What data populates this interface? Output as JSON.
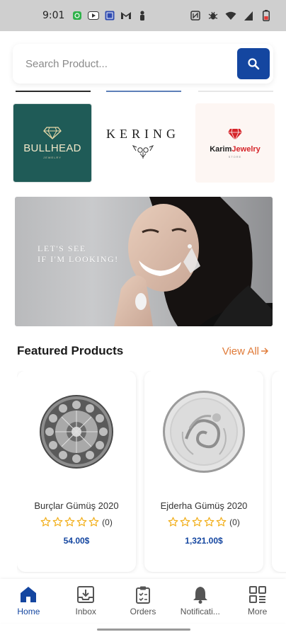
{
  "status_bar": {
    "time": "9:01",
    "left_icons": [
      "whatsapp-icon",
      "youtube-icon",
      "app-icon",
      "gmail-icon",
      "person-icon"
    ],
    "right_icons": [
      "nfc-icon",
      "bug-icon",
      "wifi-icon",
      "signal-icon",
      "battery-icon"
    ]
  },
  "search": {
    "placeholder": "Search Product...",
    "value": ""
  },
  "brands": [
    {
      "name": "BULLHEAD",
      "subtitle": "JEWELRY"
    },
    {
      "name": "KERING"
    },
    {
      "name": "Karim",
      "name_highlight": "Jewelry",
      "subtitle": "STORE"
    }
  ],
  "banner": {
    "line1": "LET'S SEE",
    "line2": "IF I'M LOOKING!"
  },
  "featured": {
    "title": "Featured Products",
    "view_all": "View All"
  },
  "products": [
    {
      "name": "Burçlar Gümüş 2020",
      "rating_count": "(0)",
      "price": "54.00$"
    },
    {
      "name": "Ejderha Gümüş 2020",
      "rating_count": "(0)",
      "price": "1,321.00$"
    }
  ],
  "nav": {
    "items": [
      {
        "label": "Home",
        "icon": "home-icon",
        "active": true
      },
      {
        "label": "Inbox",
        "icon": "inbox-icon"
      },
      {
        "label": "Orders",
        "icon": "clipboard-icon"
      },
      {
        "label": "Notificati...",
        "icon": "bell-icon"
      },
      {
        "label": "More",
        "icon": "grid-icon"
      }
    ]
  },
  "colors": {
    "primary": "#1446a0",
    "accent": "#e07b39",
    "star": "#f2b01e"
  }
}
